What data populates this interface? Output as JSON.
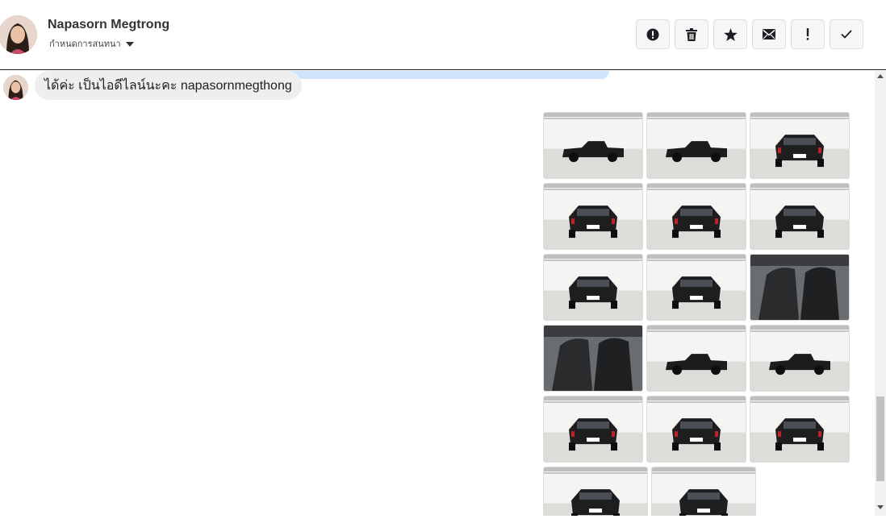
{
  "contact": {
    "name": "Napasorn Megtrong",
    "subtitle": "กำหนดการสนทนา"
  },
  "toolbar": {
    "buttons": [
      {
        "name": "spam-button",
        "icon": "alert-circle-icon"
      },
      {
        "name": "delete-button",
        "icon": "trash-icon"
      },
      {
        "name": "star-button",
        "icon": "star-icon"
      },
      {
        "name": "mark-unread-button",
        "icon": "envelope-icon"
      },
      {
        "name": "important-button",
        "icon": "exclamation-icon"
      },
      {
        "name": "done-button",
        "icon": "check-icon"
      }
    ]
  },
  "message": {
    "text": "ได้ค่ะ เป็นไอดีไลน์นะคะ napasornmegthong"
  },
  "gallery": {
    "photos": [
      {
        "view": "side-left-showroom"
      },
      {
        "view": "side-left-showroom"
      },
      {
        "view": "rear-three-quarter"
      },
      {
        "view": "rear"
      },
      {
        "view": "rear-three-quarter-left"
      },
      {
        "view": "front-three-quarter"
      },
      {
        "view": "front"
      },
      {
        "view": "front-three-quarter"
      },
      {
        "view": "interior-rear-seats"
      },
      {
        "view": "interior-front-seats"
      },
      {
        "view": "side-left-showroom"
      },
      {
        "view": "side-left-showroom"
      },
      {
        "view": "rear-three-quarter"
      },
      {
        "view": "rear"
      },
      {
        "view": "rear-three-quarter-left"
      },
      {
        "view": "front-three-quarter"
      },
      {
        "view": "front"
      }
    ]
  },
  "colors": {
    "accent_blue": "#cfe3fb",
    "bubble_bg": "#eeeeef"
  }
}
